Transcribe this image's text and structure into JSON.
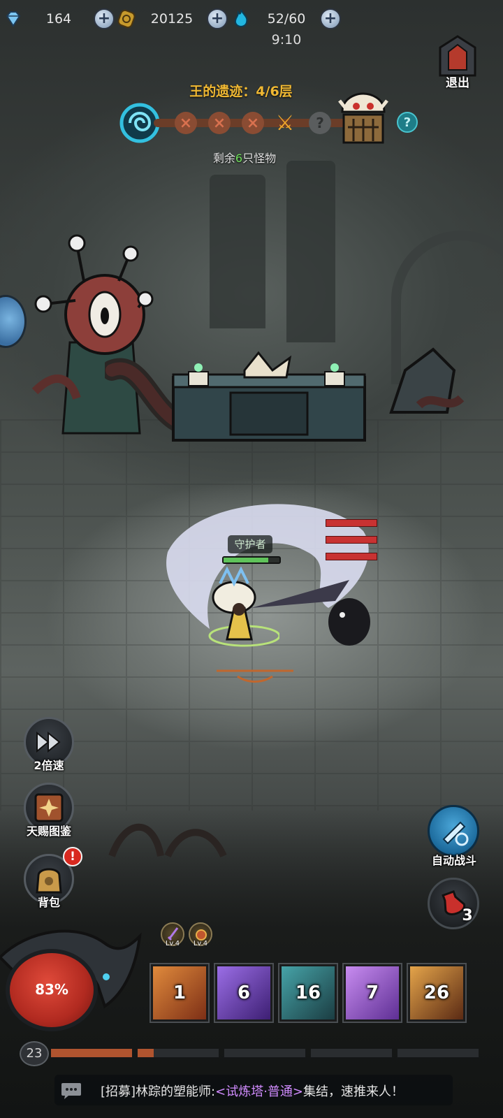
{
  "resources": {
    "gems": "164",
    "gold": "20125",
    "energy": "52/60",
    "time": "9:10"
  },
  "exit": {
    "label": "退出"
  },
  "stage": {
    "title": "王的遗迹：4/6层",
    "remaining_prefix": "剩余",
    "remaining_count": "6",
    "remaining_suffix": "只怪物",
    "nodes": [
      "cleared",
      "cleared",
      "cleared",
      "current",
      "locked",
      "boss"
    ],
    "help_label": "?"
  },
  "hero": {
    "name": "守护者",
    "hp_fraction": 0.8
  },
  "enemy": {
    "hp_bars": 3
  },
  "left_buttons": {
    "speed_label": "2倍速",
    "codex_label": "天赐图鉴",
    "bag_label": "背包",
    "bag_badge": "!"
  },
  "right_buttons": {
    "auto_label": "自动战斗",
    "potion_count": "3"
  },
  "player": {
    "hp_percent": "83%",
    "level": "23",
    "xp_segments": [
      1.0,
      0.2,
      0,
      0,
      0
    ]
  },
  "passives": [
    {
      "icon": "purple-sword-icon",
      "level": "Lv.4"
    },
    {
      "icon": "gem-orb-icon",
      "level": "Lv.4"
    }
  ],
  "skills": [
    {
      "icon": "fist-skill-icon",
      "cooldown": "1",
      "color": "#c25a2a"
    },
    {
      "icon": "purple-slash-skill-icon",
      "cooldown": "6",
      "color": "#6b3fb0"
    },
    {
      "icon": "ice-blade-skill-icon",
      "cooldown": "16",
      "color": "#2c6a6e"
    },
    {
      "icon": "skull-skill-icon",
      "cooldown": "7",
      "color": "#a05cd8"
    },
    {
      "icon": "explosion-skill-icon",
      "cooldown": "26",
      "color": "#b3642a"
    }
  ],
  "chat": {
    "prefix": "[招募]林踪的塑能师:",
    "highlight": "<试炼塔·普通>",
    "suffix": "集结，速推来人！"
  }
}
